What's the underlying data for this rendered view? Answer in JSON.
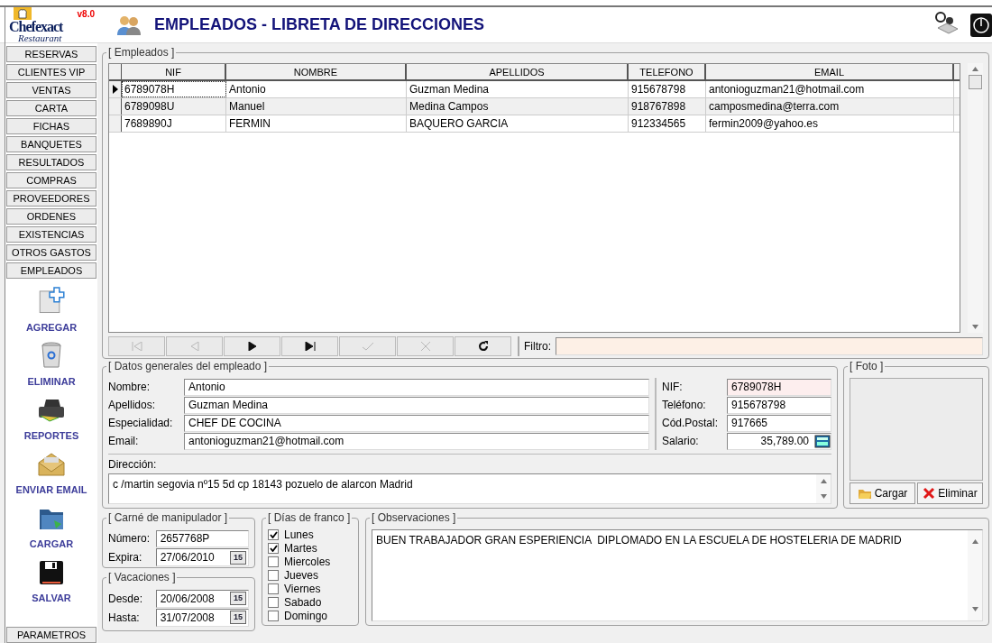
{
  "logo": {
    "name": "Chefexact",
    "subtitle": "Restaurant",
    "version": "v8.0"
  },
  "window": {
    "title": "EMPLEADOS - LIBRETA DE DIRECCIONES"
  },
  "sidebar": {
    "menu": [
      {
        "label": "RESERVAS"
      },
      {
        "label": "CLIENTES VIP"
      },
      {
        "label": "VENTAS"
      },
      {
        "label": "CARTA"
      },
      {
        "label": "FICHAS"
      },
      {
        "label": "BANQUETES"
      },
      {
        "label": "RESULTADOS"
      },
      {
        "label": "COMPRAS"
      },
      {
        "label": "PROVEEDORES"
      },
      {
        "label": "ORDENES"
      },
      {
        "label": "EXISTENCIAS"
      },
      {
        "label": "OTROS GASTOS"
      },
      {
        "label": "EMPLEADOS"
      }
    ],
    "actions": [
      {
        "kind": "add",
        "label": "AGREGAR"
      },
      {
        "kind": "delete",
        "label": "ELIMINAR"
      },
      {
        "kind": "print",
        "label": "REPORTES"
      },
      {
        "kind": "mail",
        "label": "ENVIAR EMAIL"
      },
      {
        "kind": "load",
        "label": "CARGAR"
      },
      {
        "kind": "save",
        "label": "SALVAR"
      }
    ],
    "footer": "PARAMETROS"
  },
  "table": {
    "title": "[ Empleados ]",
    "columns": [
      "NIF",
      "NOMBRE",
      "APELLIDOS",
      "TELEFONO",
      "EMAIL"
    ],
    "rows": [
      {
        "selected": true,
        "cells": [
          "6789078H",
          "Antonio",
          "Guzman Medina",
          "915678798",
          "antonioguzman21@hotmail.com"
        ]
      },
      {
        "selected": false,
        "cells": [
          "6789098U",
          "Manuel",
          "Medina Campos",
          "918767898",
          "camposmedina@terra.com"
        ]
      },
      {
        "selected": false,
        "cells": [
          "7689890J",
          "FERMIN",
          "BAQUERO GARCIA",
          "912334565",
          "fermin2009@yahoo.es"
        ]
      }
    ]
  },
  "navigator": {
    "buttons": [
      {
        "kind": "first",
        "disabled": true
      },
      {
        "kind": "prev",
        "disabled": true
      },
      {
        "kind": "next",
        "disabled": false
      },
      {
        "kind": "last",
        "disabled": false
      },
      {
        "kind": "post",
        "disabled": true
      },
      {
        "kind": "cancel",
        "disabled": true
      },
      {
        "kind": "refresh",
        "disabled": false
      }
    ],
    "filter_label": "Filtro:"
  },
  "details": {
    "title": "[ Datos generales del empleado ]",
    "left_fields": [
      {
        "label": "Nombre:",
        "value": "Antonio"
      },
      {
        "label": "Apellidos:",
        "value": "Guzman Medina"
      },
      {
        "label": "Especialidad:",
        "value": "CHEF DE COCINA"
      },
      {
        "label": "Email:",
        "value": "antonioguzman21@hotmail.com"
      }
    ],
    "right_fields": [
      {
        "kind": "key",
        "label": "NIF:",
        "value": "6789078H"
      },
      {
        "kind": "text",
        "label": "Teléfono:",
        "value": "915678798"
      },
      {
        "kind": "text",
        "label": "Cód.Postal:",
        "value": "917665"
      },
      {
        "kind": "money",
        "label": "Salario:",
        "value": "35,789.00"
      }
    ],
    "address_label": "Dirección:",
    "address": "c /martin segovia nº15 5d cp 18143 pozuelo de alarcon Madrid"
  },
  "photo": {
    "title": "[ Foto ]",
    "buttons": [
      {
        "kind": "load",
        "label": "Cargar"
      },
      {
        "kind": "delete",
        "label": "Eliminar"
      }
    ]
  },
  "license": {
    "title": "[ Carné de manipulador ]",
    "number_label": "Número:",
    "number": "2657768P",
    "expires_label": "Expira:",
    "expires": "27/06/2010",
    "expires_calendar": "15"
  },
  "vacation": {
    "title": "[ Vacaciones ]",
    "from_label": "Desde:",
    "from": "20/06/2008",
    "from_calendar": "15",
    "to_label": "Hasta:",
    "to": "31/07/2008",
    "to_calendar": "15"
  },
  "days_off": {
    "title": "[ Días de franco ]",
    "days": [
      {
        "label": "Lunes",
        "checked": true
      },
      {
        "label": "Martes",
        "checked": true
      },
      {
        "label": "Miercoles",
        "checked": false
      },
      {
        "label": "Jueves",
        "checked": false
      },
      {
        "label": "Viernes",
        "checked": false
      },
      {
        "label": "Sabado",
        "checked": false
      },
      {
        "label": "Domingo",
        "checked": false
      }
    ]
  },
  "notes": {
    "title": "[ Observaciones ]",
    "text": "BUEN TRABAJADOR GRAN ESPERIENCIA  DIPLOMADO EN LA ESCUELA DE HOSTELERIA DE MADRID"
  }
}
